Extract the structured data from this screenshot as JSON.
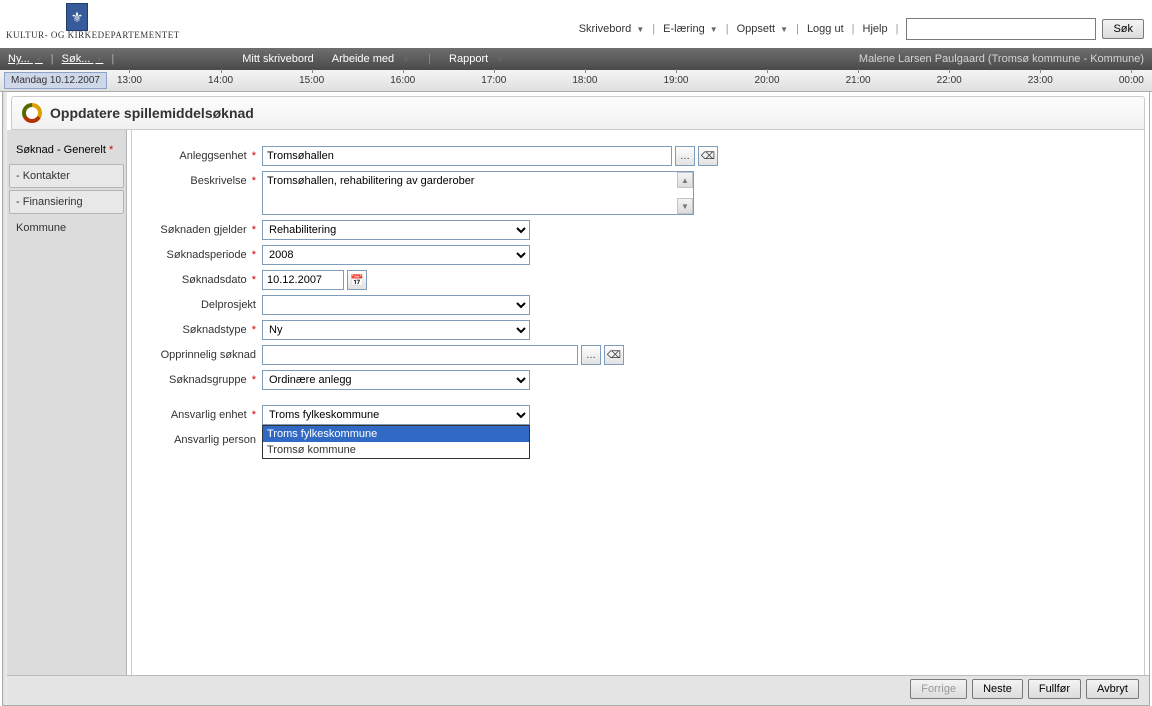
{
  "header": {
    "department": "Kultur- og Kirkedepartementet",
    "menu": {
      "skrivebord": "Skrivebord",
      "elaering": "E-læring",
      "oppsett": "Oppsett",
      "loggut": "Logg ut",
      "hjelp": "Hjelp"
    },
    "search_btn": "Søk"
  },
  "darkbar": {
    "ny": "Ny...",
    "sok": "Søk...",
    "mitt": "Mitt skrivebord",
    "arbeide": "Arbeide med",
    "rapport": "Rapport",
    "user": "Malene Larsen Paulgaard (Tromsø kommune - Kommune)"
  },
  "timeline": {
    "date": "Mandag 10.12.2007",
    "hours": [
      "13:00",
      "14:00",
      "15:00",
      "16:00",
      "17:00",
      "18:00",
      "19:00",
      "20:00",
      "21:00",
      "22:00",
      "23:00",
      "00:00"
    ]
  },
  "page": {
    "title": "Oppdatere spillemiddelsøknad"
  },
  "sidetabs": {
    "main": "Søknad - Generelt",
    "kontakter": "- Kontakter",
    "finansiering": "- Finansiering",
    "kommune": "Kommune"
  },
  "form": {
    "anleggsenhet": {
      "label": "Anleggsenhet",
      "value": "Tromsøhallen"
    },
    "beskrivelse": {
      "label": "Beskrivelse",
      "value": "Tromsøhallen, rehabilitering av garderober"
    },
    "gjelder": {
      "label": "Søknaden gjelder",
      "value": "Rehabilitering"
    },
    "periode": {
      "label": "Søknadsperiode",
      "value": "2008"
    },
    "dato": {
      "label": "Søknadsdato",
      "value": "10.12.2007"
    },
    "delprosjekt": {
      "label": "Delprosjekt",
      "value": ""
    },
    "type": {
      "label": "Søknadstype",
      "value": "Ny"
    },
    "opprinnelig": {
      "label": "Opprinnelig søknad",
      "value": ""
    },
    "gruppe": {
      "label": "Søknadsgruppe",
      "value": "Ordinære anlegg"
    },
    "enhet": {
      "label": "Ansvarlig enhet",
      "value": "Troms fylkeskommune",
      "options": [
        "Troms fylkeskommune",
        "Tromsø kommune"
      ]
    },
    "person": {
      "label": "Ansvarlig person",
      "value": ""
    }
  },
  "footer": {
    "forrige": "Forrige",
    "neste": "Neste",
    "fullfor": "Fullfør",
    "avbryt": "Avbryt"
  }
}
